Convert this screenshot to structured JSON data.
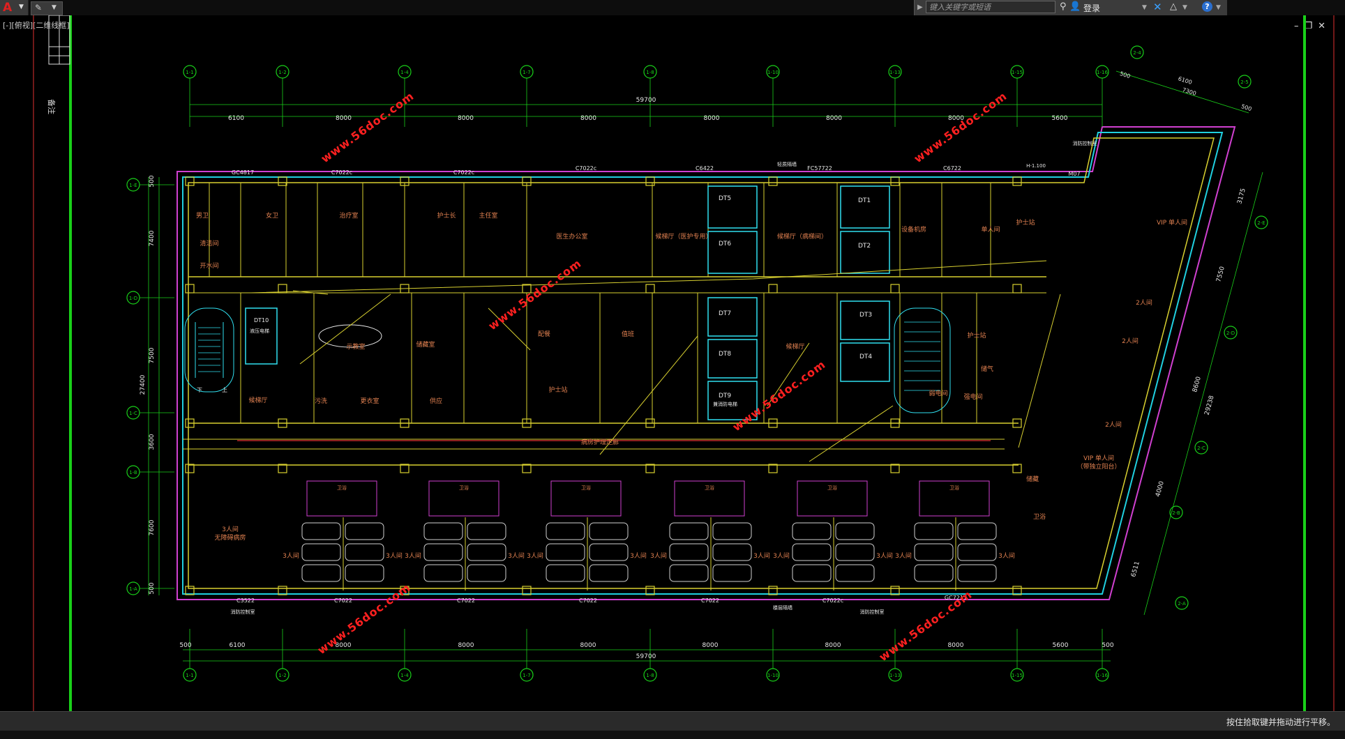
{
  "toolbar": {
    "app_letter": "A",
    "search_placeholder": "键入关键字或短语",
    "login_label": "登录"
  },
  "viewport": {
    "label": "[-][俯视][二维线框]"
  },
  "colors": {
    "background": "#000000",
    "axis_green": "#19d019",
    "wall_yellow": "#d8d030",
    "window_cyan": "#20d0e0",
    "outline_magenta": "#d040d0",
    "elevator_cyan": "#30e0f0",
    "pipe_red": "#e03030",
    "label_orange": "#e08050",
    "watermark": "#ff2020"
  },
  "drawing": {
    "left_vertical_label": "备注",
    "top_axes": [
      "1-1",
      "1-2",
      "1-4",
      "1-7",
      "1-8",
      "1-10",
      "1-13",
      "1-15",
      "1-16"
    ],
    "bottom_axes": [
      "1-1",
      "1-2",
      "1-4",
      "1-7",
      "1-8",
      "1-10",
      "1-13",
      "1-15",
      "1-16"
    ],
    "left_axes": [
      "1-E",
      "1-D",
      "1-C",
      "1-B",
      "1-A"
    ],
    "right_axes": [
      "2-E",
      "2-D",
      "2-C",
      "2-B",
      "2-A"
    ],
    "right_top_axes": [
      "2-4",
      "2-5"
    ],
    "top_total_dim": "59700",
    "top_dims": [
      "6100",
      "8000",
      "8000",
      "8000",
      "8000",
      "8000",
      "8000",
      "5600"
    ],
    "bottom_total_dim": "59700",
    "bottom_dims": [
      "500",
      "6100",
      "8000",
      "8000",
      "8000",
      "8000",
      "8000",
      "8000",
      "5600",
      "500"
    ],
    "left_dims": [
      "500",
      "7400",
      "7500",
      "27400",
      "3600",
      "7600",
      "500"
    ],
    "right_dims": [
      "3175",
      "7550",
      "8600",
      "29238",
      "4000",
      "6511"
    ],
    "right_top_dims": [
      "500",
      "6100",
      "7300",
      "500"
    ],
    "window_labels_top": [
      "GC4817",
      "C7022c",
      "C7022c",
      "C7022c",
      "C6422",
      "FC57722",
      "C6722",
      "M07"
    ],
    "window_labels_bottom": [
      "C3522",
      "C7022",
      "C7022",
      "C7022",
      "C7022",
      "C7022c",
      "GC7217"
    ],
    "top_notes": [
      "轻质隔墙",
      "H-1.100",
      "消防控制室"
    ],
    "bottom_notes": [
      "消防控制室",
      "消防控制室",
      "楼层隔墙"
    ],
    "rooms": {
      "nurse_toilet": "男卫",
      "ladies": "女卫",
      "cleaning": "清洁间",
      "utility": "开水间",
      "treatment": "治疗室",
      "nurse_office": "护士长",
      "director_office": "主任室",
      "doctor_office": "医生办公室",
      "waiting_mid": "候梯厅（医护专用）",
      "dt5": "DT5",
      "dt6": "DT6",
      "lobby": "候梯厅（病梯间）",
      "dt1": "DT1",
      "dt2": "DT2",
      "equip": "设备机房",
      "single": "单人间",
      "meeting": "示教室",
      "store": "储藏室",
      "dining": "配餐",
      "duty": "值班",
      "nurse_station": "护士站",
      "dt7": "DT7",
      "dt8": "DT8",
      "dt9": "DT9",
      "dt9b": "兼消防电梯",
      "hall_right": "候梯厅",
      "dt3": "DT3",
      "dt4": "DT4",
      "nurse_work": "护士站",
      "dt10": "DT10",
      "dt10b": "液压电梯",
      "sick_lobby": "候梯厅",
      "cleaning2": "污洗",
      "change": "更衣室",
      "supply": "供应",
      "corridor": "病房护理走廊",
      "toilet_sub": "卫浴",
      "ward3_1": "3人间",
      "ward3_2": "3人间",
      "ward3_3": "3人间",
      "ward3_4": "3人间",
      "ward3_5": "3人间",
      "ward3_6": "3人间",
      "ward3_7": "3人间",
      "ward3_8": "3人间",
      "ward3_9": "3人间",
      "ward3_10": "3人间",
      "ward3_11": "3人间",
      "ward3_12": "3人间",
      "ward_special": "3人间",
      "ward_special_b": "无障碍病房",
      "vip1": "VIP 单人间",
      "ward2_1": "2人间",
      "ward2_2": "2人间",
      "ward2_3": "2人间",
      "vip2": "VIP 单人间",
      "vip2_sub": "（带独立阳台）",
      "storage_r": "储藏",
      "toilet_r": "卫浴",
      "stairs_note": "强电间",
      "weak": "弱电间",
      "nurse_rest": "护士站",
      "stair_desc": "下",
      "stair_up": "上",
      "gas": "储气"
    },
    "watermarks": [
      "www.56doc.com",
      "www.56doc.com",
      "www.56doc.com",
      "www.56doc.com",
      "www.56doc.com",
      "www.56doc.com",
      "www.56doc.com"
    ]
  },
  "status": {
    "message": "按住拾取键并拖动进行平移。"
  }
}
